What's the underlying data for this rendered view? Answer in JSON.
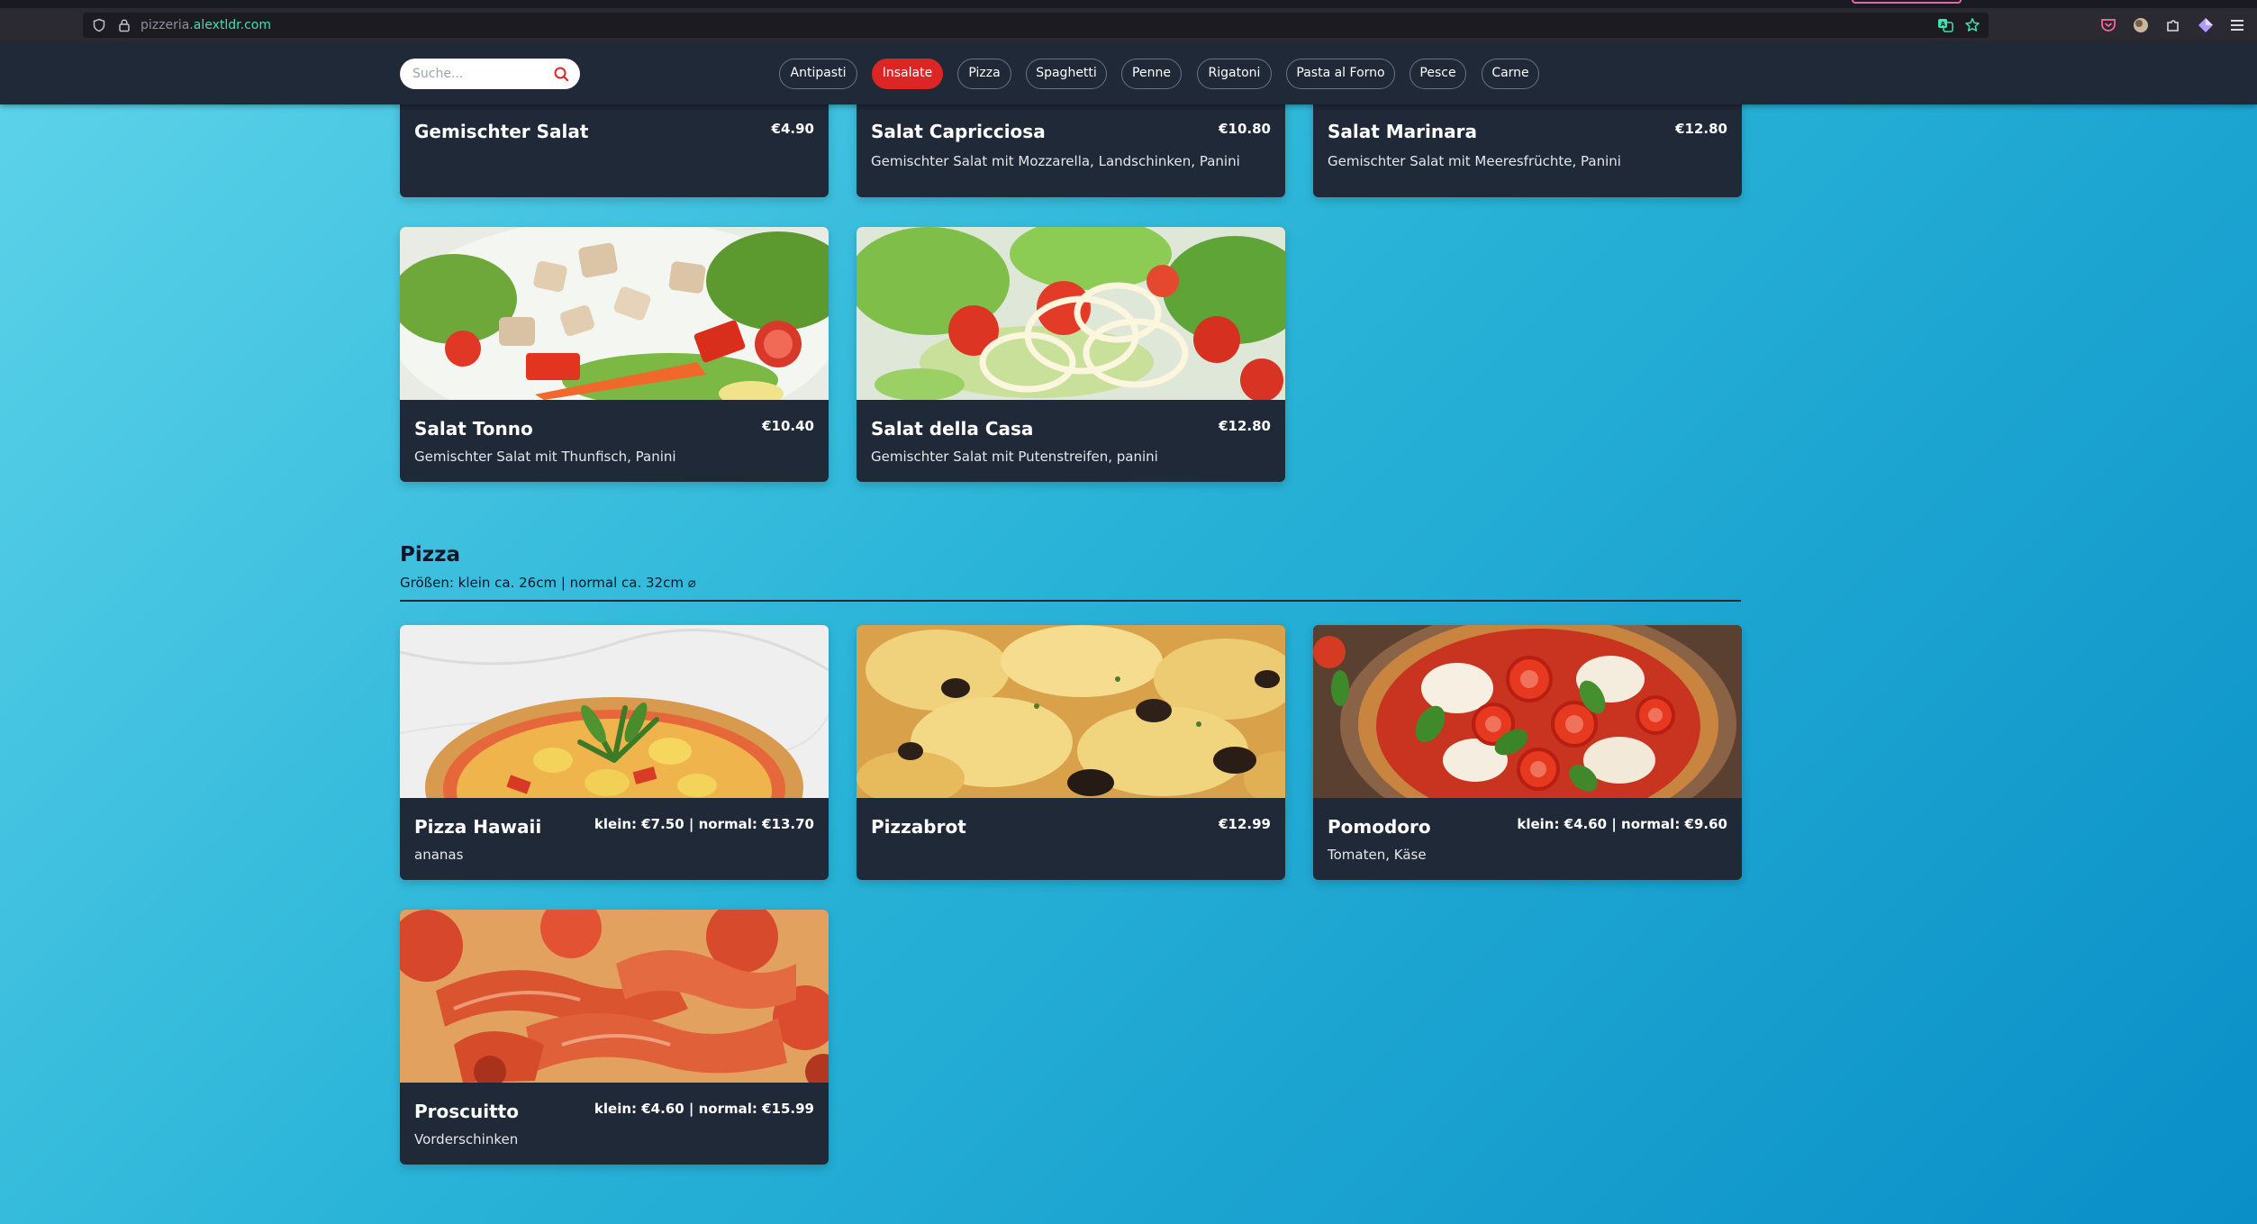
{
  "browser": {
    "url_prefix": "pizzeria.",
    "url_domain": "alextldr.com"
  },
  "header": {
    "search_placeholder": "Suche...",
    "categories": [
      "Antipasti",
      "Insalate",
      "Pizza",
      "Spaghetti",
      "Penne",
      "Rigatoni",
      "Pasta al Forno",
      "Pesce",
      "Carne"
    ],
    "active_category": "Insalate"
  },
  "salads": {
    "items": [
      {
        "name": "Gemischter Salat",
        "price": "€4.90",
        "desc": ""
      },
      {
        "name": "Salat Capricciosa",
        "price": "€10.80",
        "desc": "Gemischter Salat mit Mozzarella, Landschinken, Panini"
      },
      {
        "name": "Salat Marinara",
        "price": "€12.80",
        "desc": "Gemischter Salat mit Meeresfrüchte, Panini"
      },
      {
        "name": "Salat Tonno",
        "price": "€10.40",
        "desc": "Gemischter Salat mit Thunfisch, Panini"
      },
      {
        "name": "Salat della Casa",
        "price": "€12.80",
        "desc": "Gemischter Salat mit Putenstreifen, panini"
      }
    ]
  },
  "pizza_section": {
    "title": "Pizza",
    "subtitle": "Größen: klein ca. 26cm | normal ca. 32cm ⌀",
    "items": [
      {
        "name": "Pizza Hawaii",
        "price": "klein: €7.50 | normal: €13.70",
        "desc": "ananas"
      },
      {
        "name": "Pizzabrot",
        "price": "€12.99",
        "desc": ""
      },
      {
        "name": "Pomodoro",
        "price": "klein: €4.60 | normal: €9.60",
        "desc": "Tomaten, Käse"
      },
      {
        "name": "Proscuitto",
        "price": "klein: €4.60 | normal: €15.99",
        "desc": "Vorderschinken"
      }
    ]
  },
  "colors": {
    "accent": "#dc2626",
    "card_bg": "#1f2937",
    "header_bg": "#1f2937"
  }
}
